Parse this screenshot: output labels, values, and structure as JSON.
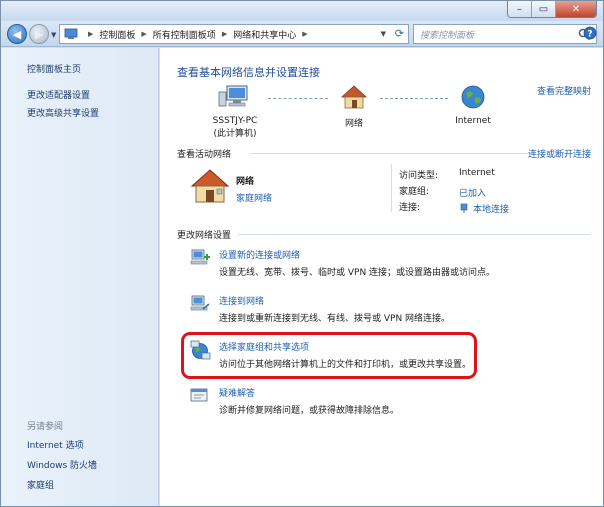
{
  "window": {
    "controls": [
      "–",
      "▭",
      "✕"
    ]
  },
  "address_bar": {
    "crumbs": [
      "控制面板",
      "所有控制面板项",
      "网络和共享中心"
    ]
  },
  "search": {
    "placeholder": "搜索控制面板"
  },
  "sidebar": {
    "home": "控制面板主页",
    "adapter": "更改适配器设置",
    "advanced": "更改高级共享设置",
    "see_also": "另请参阅",
    "internet_options": "Internet 选项",
    "firewall": "Windows 防火墙",
    "homegroup": "家庭组"
  },
  "main": {
    "heading": "查看基本网络信息并设置连接",
    "full_map": "查看完整映射",
    "map": {
      "pc_name": "SSSTJY-PC",
      "pc_sub": "(此计算机)",
      "network": "网络",
      "internet": "Internet"
    },
    "active_heading": "查看活动网络",
    "connect_link": "连接或断开连接",
    "active_network": {
      "name": "网络",
      "type": "家庭网络",
      "access_type_label": "访问类型:",
      "access_type_value": "Internet",
      "homegroup_label": "家庭组:",
      "homegroup_value": "已加入",
      "connection_label": "连接:",
      "connection_value": "本地连接"
    },
    "change_heading": "更改网络设置",
    "tasks": [
      {
        "title": "设置新的连接或网络",
        "desc": "设置无线、宽带、拨号、临时或 VPN 连接；或设置路由器或访问点。"
      },
      {
        "title": "连接到网络",
        "desc": "连接到或重新连接到无线、有线、拨号或 VPN 网络连接。"
      },
      {
        "title": "选择家庭组和共享选项",
        "desc": "访问位于其他网络计算机上的文件和打印机，或更改共享设置。"
      },
      {
        "title": "疑难解答",
        "desc": "诊断并修复网络问题，或获得故障排除信息。"
      }
    ]
  },
  "colors": {
    "link": "#1e5fb5",
    "heading": "#1e4d9a",
    "highlight": "#e0111b",
    "sidebar_bg": "#e4eef9"
  }
}
